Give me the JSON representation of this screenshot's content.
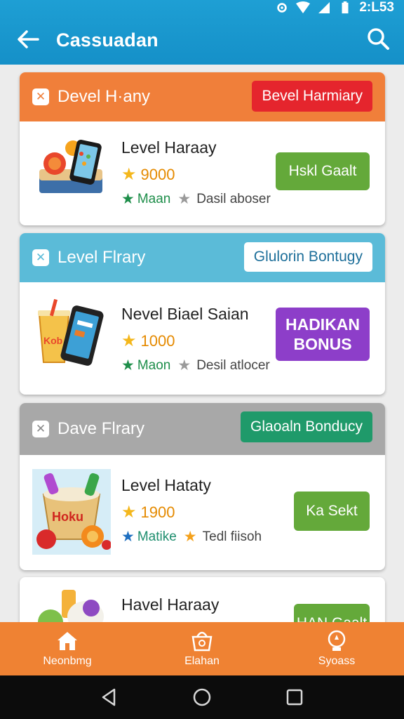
{
  "status_bar": {
    "time": "2:L53"
  },
  "app_bar": {
    "title": "Cassuadan"
  },
  "cards": [
    {
      "header_title": "Devel H·any",
      "header_button": "Bevel Harmiary",
      "header_color": "#f07f3a",
      "header_button_bg": "#e5252d",
      "header_button_fg": "#ffffff",
      "level": "Level Haraay",
      "points": "9000",
      "meta_primary": "Maan",
      "meta_secondary": "Dasil aboser",
      "action": "Hskl Gaalt",
      "action_color": "#64a93a"
    },
    {
      "header_title": "Level Flrary",
      "header_button": "Glulorin Bontugy",
      "header_color": "#5bbbd8",
      "header_button_bg": "#ffffff",
      "header_button_fg": "#1e6f9a",
      "level": "Nevel Biael Saian",
      "points": "1000",
      "meta_primary": "Maon",
      "meta_secondary": "Desil atlocer",
      "action": "HADIKAN BONUS",
      "action_color": "#8d3ec9"
    },
    {
      "header_title": "Dave Flrary",
      "header_button": "Glaoaln Bonducy",
      "header_color": "#a8a8a8",
      "header_button_bg": "#1f9a6a",
      "header_button_fg": "#ffffff",
      "level": "Level Hataty",
      "points": "1900",
      "meta_primary": "Matike",
      "meta_secondary": "Tedl fiisoh",
      "action": "Ka Sekt",
      "action_color": "#64a93a"
    },
    {
      "level": "Havel Haraay",
      "action": "HAN Gaalt",
      "action_color": "#64a93a"
    }
  ],
  "bottom_nav": [
    {
      "label": "Neonbmg",
      "icon": "home-icon"
    },
    {
      "label": "Elahan",
      "icon": "basket-icon"
    },
    {
      "label": "Syoass",
      "icon": "trophy-icon"
    }
  ],
  "system_nav": [
    "back-icon",
    "home-circle-icon",
    "recents-icon"
  ]
}
